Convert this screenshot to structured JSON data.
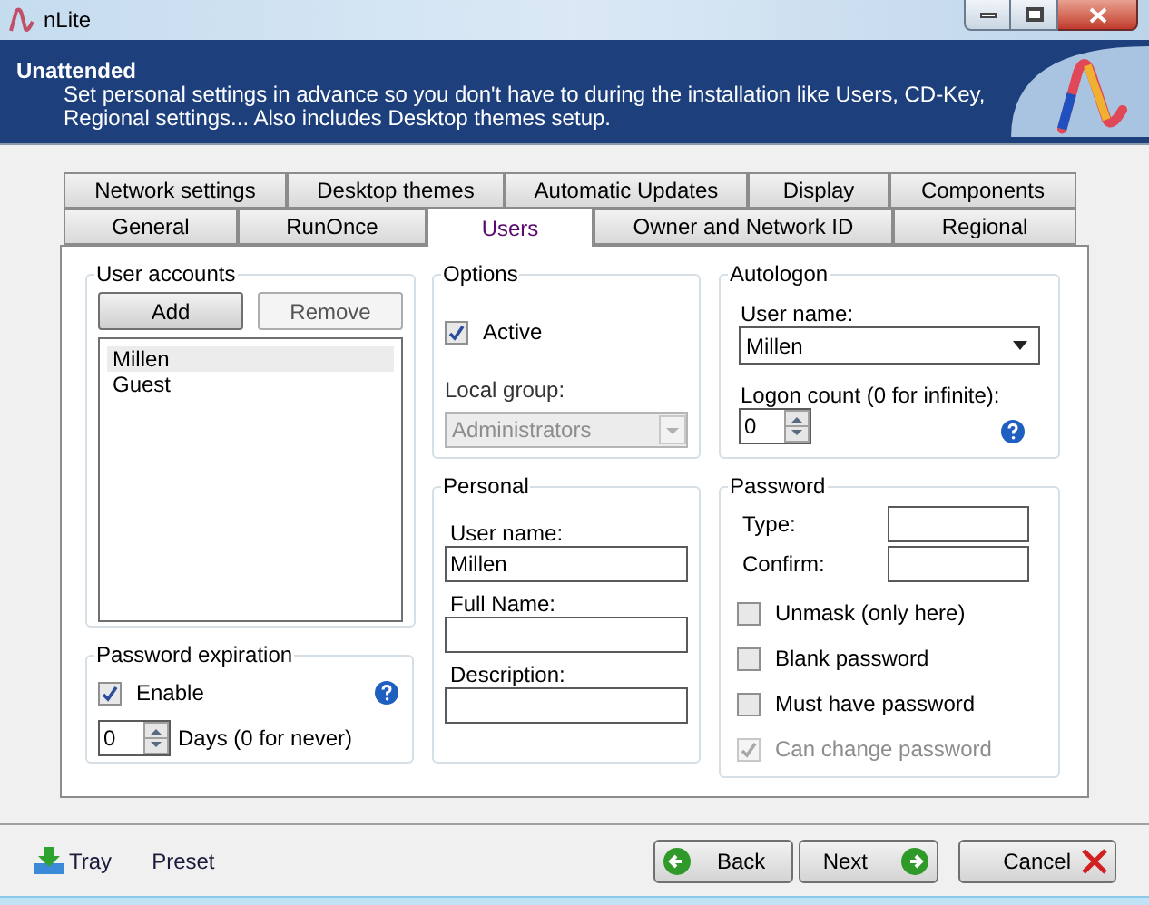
{
  "window": {
    "title": "nLite"
  },
  "header": {
    "title": "Unattended",
    "description_lines": [
      "Set personal settings in advance so you don't have to during the installation like Users, CD-Key,",
      "Regional settings... Also includes Desktop themes setup."
    ]
  },
  "tab_rows": [
    [
      {
        "label": "Network settings",
        "selected": false
      },
      {
        "label": "Desktop themes",
        "selected": false
      },
      {
        "label": "Automatic Updates",
        "selected": false
      },
      {
        "label": "Display",
        "selected": false
      },
      {
        "label": "Components",
        "selected": false
      }
    ],
    [
      {
        "label": "General",
        "selected": false
      },
      {
        "label": "RunOnce",
        "selected": false
      },
      {
        "label": "Users",
        "selected": true
      },
      {
        "label": "Owner and Network ID",
        "selected": false
      },
      {
        "label": "Regional",
        "selected": false
      }
    ]
  ],
  "user_accounts": {
    "title": "User accounts",
    "buttons": [
      {
        "label": "Add",
        "default": true
      },
      {
        "label": "Remove",
        "default": false
      }
    ],
    "users": [
      {
        "name": "Millen",
        "selected": true
      },
      {
        "name": "Guest",
        "selected": false
      }
    ]
  },
  "password_expiration": {
    "title": "Password expiration",
    "enable": {
      "label": "Enable",
      "checked": true
    },
    "days": {
      "value": "0",
      "label": "Days (0 for never)"
    }
  },
  "options": {
    "title": "Options",
    "active": {
      "label": "Active",
      "checked": true
    },
    "local_group": {
      "label": "Local group:",
      "value": "Administrators",
      "disabled": true
    }
  },
  "personal": {
    "title": "Personal",
    "fields": [
      {
        "label": "User name:",
        "value": "Millen"
      },
      {
        "label": "Full Name:"
      },
      {
        "label": "Description:"
      }
    ]
  },
  "autologon": {
    "title": "Autologon",
    "user_name": {
      "label": "User name:",
      "value": "Millen"
    },
    "logon_count": {
      "label": "Logon count (0 for infinite):",
      "value": "0"
    }
  },
  "password": {
    "title": "Password",
    "fields": [
      {
        "label": "Type:"
      },
      {
        "label": "Confirm:"
      }
    ],
    "options": [
      {
        "label": "Unmask (only here)",
        "checked": false,
        "disabled": false
      },
      {
        "label": "Blank password",
        "checked": false,
        "disabled": false
      },
      {
        "label": "Must have password",
        "checked": false,
        "disabled": false
      },
      {
        "label": "Can change password",
        "checked": true,
        "disabled": true
      }
    ]
  },
  "footer": {
    "links": [
      {
        "label": "Tray",
        "kind": "tray"
      },
      {
        "label": "Preset",
        "kind": "plain"
      }
    ],
    "nav": [
      {
        "label": "Back",
        "kind": "back"
      },
      {
        "label": "Next",
        "kind": "next"
      },
      {
        "label": "Cancel",
        "kind": "cancel"
      }
    ]
  }
}
